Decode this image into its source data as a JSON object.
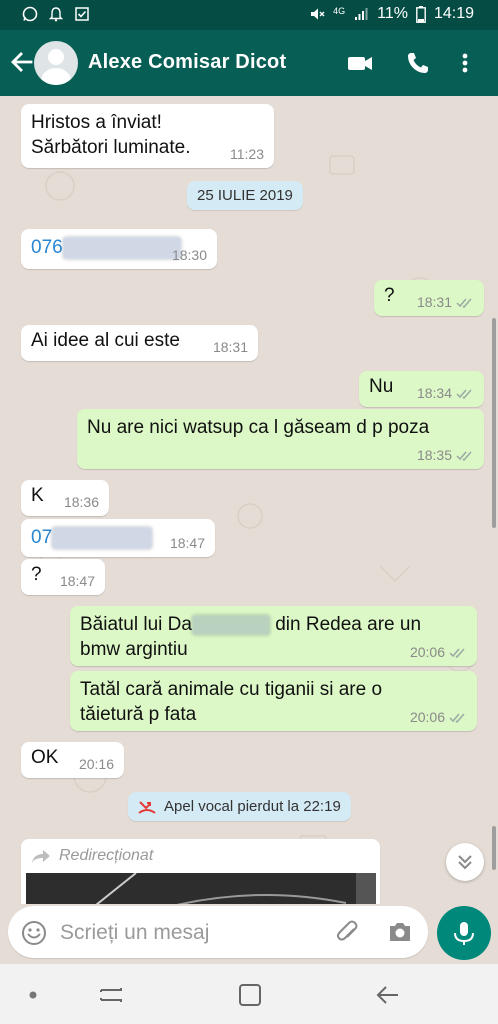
{
  "status_bar": {
    "battery": "11%",
    "time": "14:19",
    "network": "4G"
  },
  "header": {
    "contact_name": "Alexe Comisar Dicot"
  },
  "messages": [
    {
      "dir": "in",
      "text": "Hristos a înviat!\nSărbători luminate.",
      "time": "11:23"
    },
    {
      "dir": "date",
      "text": "25 IULIE 2019"
    },
    {
      "dir": "in",
      "text": "076",
      "time": "18:30",
      "redacted": true
    },
    {
      "dir": "out",
      "text": "?",
      "time": "18:31"
    },
    {
      "dir": "in",
      "text": "Ai idee al cui este",
      "time": "18:31"
    },
    {
      "dir": "out",
      "text": "Nu",
      "time": "18:34"
    },
    {
      "dir": "out",
      "text": "Nu are nici watsup ca l găseam d p poza",
      "time": "18:35"
    },
    {
      "dir": "in",
      "text": "K",
      "time": "18:36"
    },
    {
      "dir": "in",
      "text": "07",
      "time": "18:47",
      "redacted": true
    },
    {
      "dir": "in",
      "text": "?",
      "time": "18:47"
    },
    {
      "dir": "out",
      "text_a": "Băiatul lui Da",
      "text_b": " din Redea are un\nbmw argintiu",
      "time": "20:06"
    },
    {
      "dir": "out",
      "text": "Tatăl cară animale cu tiganii si are o\ntăietură p fata",
      "time": "20:06"
    },
    {
      "dir": "in",
      "text": "OK",
      "time": "20:16"
    },
    {
      "dir": "call",
      "text": "Apel vocal pierdut la 22:19"
    },
    {
      "dir": "in",
      "label": "Redirecționat"
    }
  ],
  "input": {
    "placeholder": "Scrieți un mesaj"
  },
  "colors": {
    "header": "#075e54",
    "status": "#054d44",
    "chat_bg": "#e5ddd5",
    "outgoing": "#dcf8c6",
    "incoming": "#ffffff",
    "accent": "#00897b",
    "ticks": "#9aa9a4",
    "link": "#2a86d0",
    "missed_call": "#e53935"
  },
  "icons": {
    "status_left": [
      "whatsapp-icon",
      "notification-icon",
      "checkbox-icon"
    ],
    "status_right": [
      "mute-icon",
      "signal-icon",
      "battery-icon"
    ],
    "header": [
      "back-arrow-icon",
      "video-call-icon",
      "phone-icon",
      "more-icon"
    ],
    "input": [
      "emoji-icon",
      "attach-icon",
      "camera-icon",
      "mic-icon"
    ],
    "nav": [
      "dot-icon",
      "recents-icon",
      "home-icon",
      "back-icon"
    ]
  }
}
